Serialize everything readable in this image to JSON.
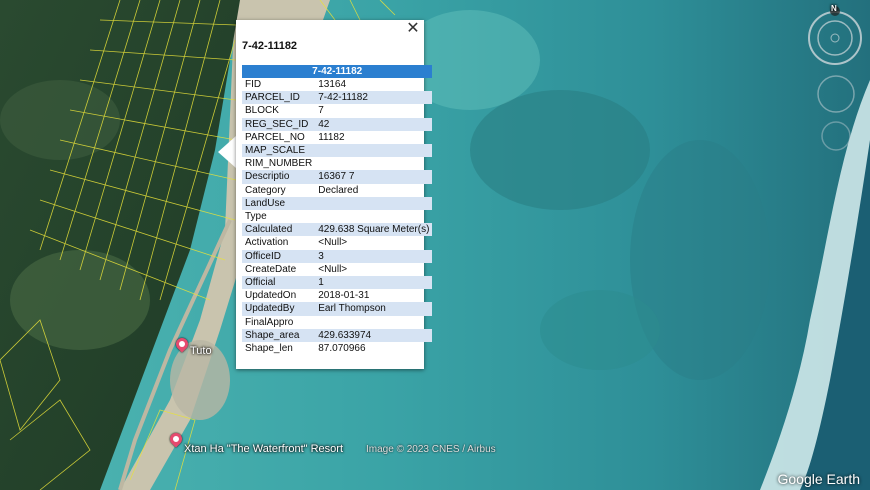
{
  "popup": {
    "title": "7-42-11182",
    "table_header": "7-42-11182",
    "close_icon": "close-icon",
    "rows": [
      {
        "key": "FID",
        "value": "13164"
      },
      {
        "key": "PARCEL_ID",
        "value": "7-42-11182"
      },
      {
        "key": "BLOCK",
        "value": "7"
      },
      {
        "key": "REG_SEC_ID",
        "value": "42"
      },
      {
        "key": "PARCEL_NO",
        "value": "11182"
      },
      {
        "key": "MAP_SCALE",
        "value": ""
      },
      {
        "key": "RIM_NUMBER",
        "value": ""
      },
      {
        "key": "Descriptio",
        "value": "16367 7"
      },
      {
        "key": "Category",
        "value": "Declared"
      },
      {
        "key": "LandUse",
        "value": ""
      },
      {
        "key": "Type",
        "value": ""
      },
      {
        "key": "Calculated",
        "value": "429.638 Square Meter(s)"
      },
      {
        "key": "Activation",
        "value": "<Null>"
      },
      {
        "key": "OfficeID",
        "value": "3"
      },
      {
        "key": "CreateDate",
        "value": "<Null>"
      },
      {
        "key": "Official",
        "value": "1"
      },
      {
        "key": "UpdatedOn",
        "value": "2018-01-31"
      },
      {
        "key": "UpdatedBy",
        "value": "Earl Thompson"
      },
      {
        "key": "FinalAppro",
        "value": ""
      },
      {
        "key": "Shape_area",
        "value": "429.633974"
      },
      {
        "key": "Shape_len",
        "value": "87.070966"
      }
    ]
  },
  "map": {
    "place_labels": {
      "tuto": "Tuto",
      "resort": "Xtan Ha \"The Waterfront\" Resort"
    },
    "credit": "Image © 2023 CNES / Airbus",
    "logo": "Google Earth",
    "compass_north": "N",
    "parcel_color": "#e8e23a",
    "pin_color": "#e64a6e"
  }
}
